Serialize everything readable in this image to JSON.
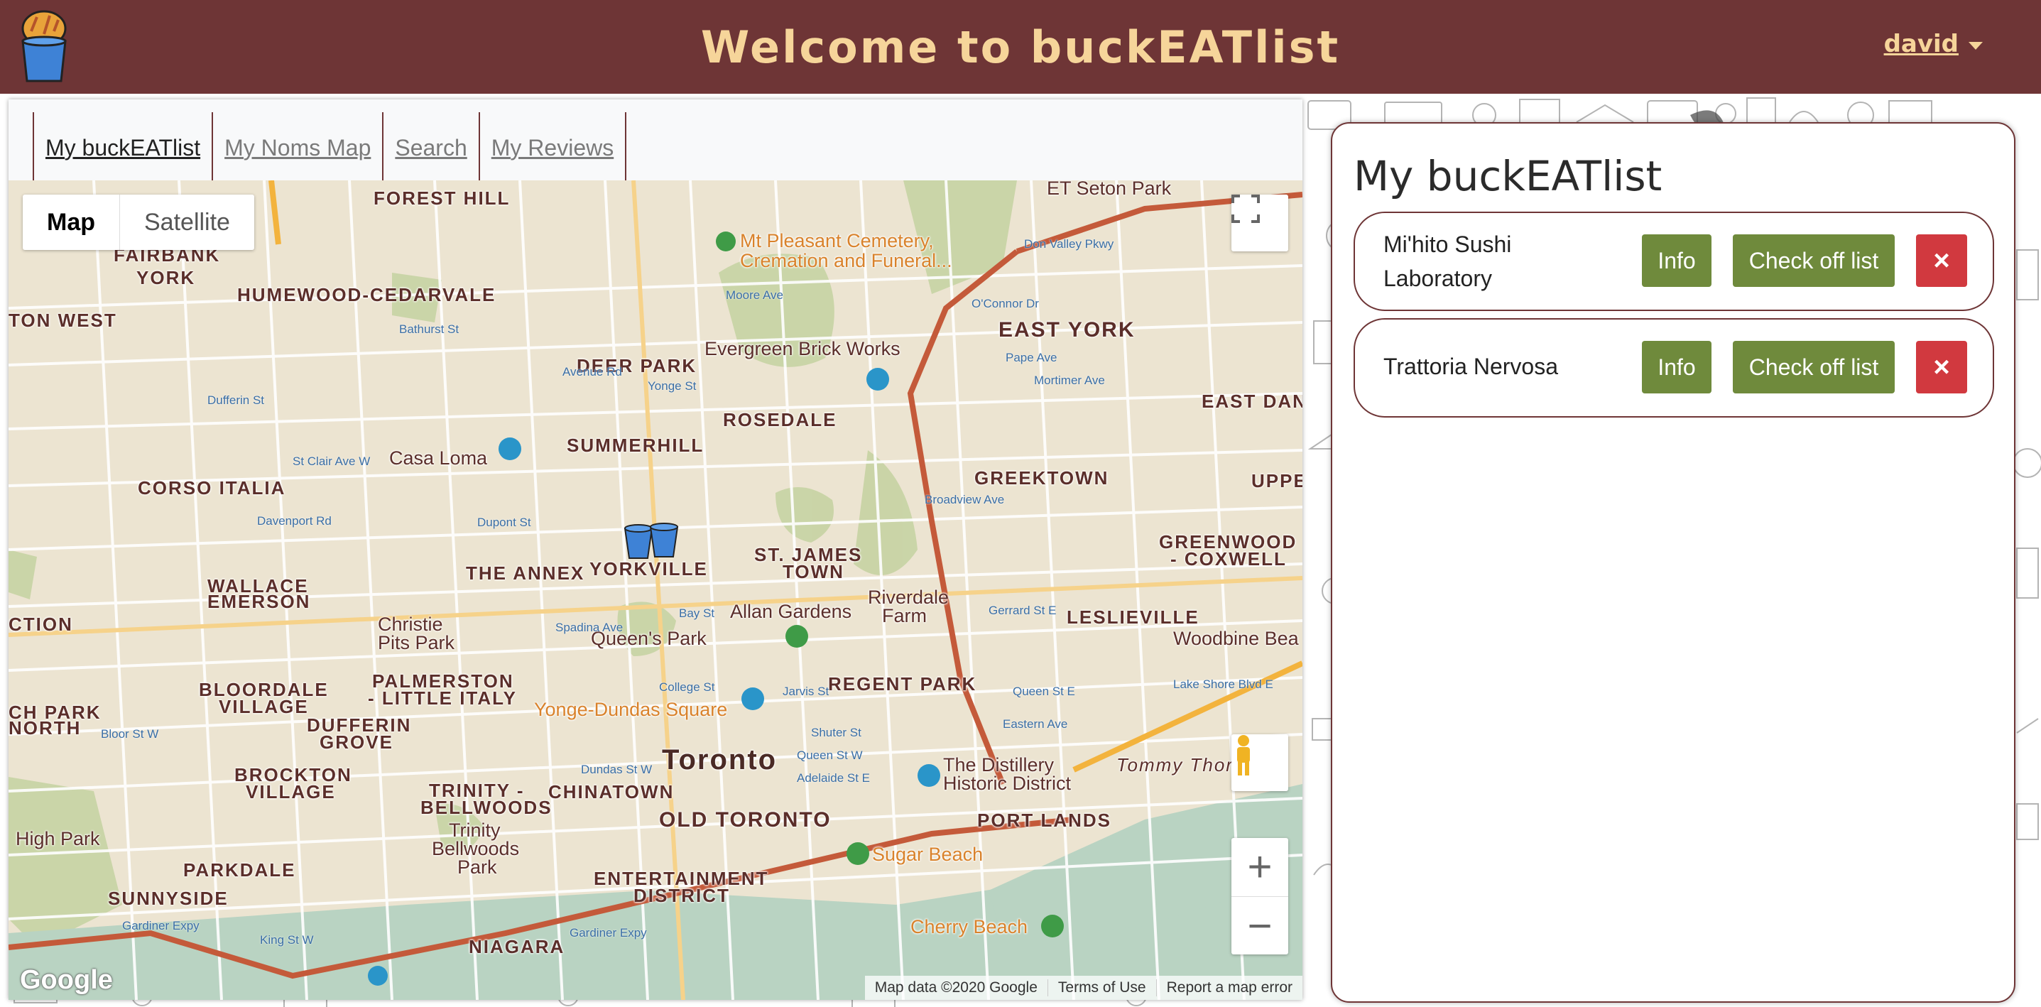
{
  "header": {
    "title": "Welcome to buckEATlist",
    "user": "david",
    "logo_icon": "bucket-logo-icon"
  },
  "nav": {
    "items": [
      {
        "label": "My buckEATlist",
        "active": true
      },
      {
        "label": "My Noms Map",
        "active": false
      },
      {
        "label": "Search",
        "active": false
      },
      {
        "label": "My Reviews",
        "active": false
      }
    ]
  },
  "map": {
    "type_options": [
      "Map",
      "Satellite"
    ],
    "selected_type": "Map",
    "attribution": [
      "Map data ©2020 Google",
      "Terms of Use",
      "Report a map error"
    ],
    "google_logo": "Google",
    "labels": {
      "forest_hill": "FOREST HILL",
      "fairbank": "FAIRBANK",
      "york": "YORK",
      "humewood": "HUMEWOOD-CEDARVALE",
      "ton_west": "TON WEST",
      "mt_pleasant": "Mt Pleasant Cemetery,",
      "mt_pleasant2": "Cremation and Funeral...",
      "et_seton": "ET Seton Park",
      "don_valley": "Don Valley Pkwy",
      "evergreen": "Evergreen Brick Works",
      "deer_park": "DEER PARK",
      "east_york": "EAST YORK",
      "rosedale": "ROSEDALE",
      "east_dan": "EAST DAN",
      "casa_loma": "Casa Loma",
      "summerhill": "SUMMERHILL",
      "corso_italia": "CORSO ITALIA",
      "greektown": "GREEKTOWN",
      "uppe": "UPPE",
      "greenwood": "GREENWOOD",
      "coxwell": "- COXWELL",
      "the_annex": "THE ANNEX",
      "yorkville": "YORKVILLE",
      "st_james": "ST. JAMES",
      "town": "TOWN",
      "wallace": "WALLACE",
      "emerson": "EMERSON",
      "christie": "Christie",
      "pits_park": "Pits Park",
      "allan_gardens": "Allan Gardens",
      "riverdale": "Riverdale",
      "farm": "Farm",
      "leslieville": "LESLIEVILLE",
      "ction": "CTION",
      "queens_park": "Queen's Park",
      "woodbine": "Woodbine Bea",
      "bloordale": "BLOORDALE",
      "village": "VILLAGE",
      "palmerston": "PALMERSTON",
      "little_italy": "- LITTLE ITALY",
      "regent_park": "REGENT PARK",
      "ch_park": "CH PARK",
      "north": "NORTH",
      "dufferin": "DUFFERIN",
      "grove": "GROVE",
      "yonge_dundas": "Yonge-Dundas Square",
      "toronto": "Toronto",
      "distillery": "The Distillery",
      "distillery2": "Historic District",
      "tommy": "Tommy Thor",
      "brockton": "BROCKTON",
      "brockton2": "VILLAGE",
      "trinity": "TRINITY -",
      "bellwoods": "BELLWOODS",
      "chinatown": "CHINATOWN",
      "old_toronto": "OLD TORONTO",
      "port_lands": "PORT LANDS",
      "high_park": "High Park",
      "trinity_park": "Trinity",
      "trinity_park2": "Bellwoods",
      "trinity_park3": "Park",
      "sugar_beach": "Sugar Beach",
      "parkdale": "PARKDALE",
      "entertainment": "ENTERTAINMENT",
      "district": "DISTRICT",
      "sunnyside": "SUNNYSIDE",
      "cherry_beach": "Cherry Beach",
      "gardiner1": "Gardiner Expy",
      "gardiner2": "Gardiner Expy",
      "niagara": "NIAGARA"
    },
    "streets": {
      "a": "St Clair Ave W",
      "b": "Davenport Rd",
      "c": "Dupont St",
      "d": "Bloor St W",
      "e": "Dundas St W",
      "f": "College St",
      "g": "Queen St W",
      "h": "King St W",
      "i": "Gerrard St E",
      "j": "Queen St E",
      "k": "Eastern Ave",
      "l": "Lake Shore Blvd E",
      "m": "Mortimer Ave",
      "n": "O'Connor Dr",
      "o": "Moore Ave",
      "p": "Bathurst St",
      "q": "Spadina Ave",
      "r": "Yonge St",
      "s": "Bay St",
      "t": "Jarvis St",
      "u": "Broadview Ave",
      "v": "Pape Ave",
      "w": "Dufferin St",
      "x": "Avenue Rd",
      "y": "Adelaide St E",
      "z": "Shuter St"
    }
  },
  "bucketlist": {
    "title": "My buckEATlist",
    "items": [
      {
        "name_line1": "Mi'hito Sushi",
        "name_line2": "Laboratory",
        "info_label": "Info",
        "check_label": "Check off list",
        "delete_label": "×"
      },
      {
        "name_line1": "Trattoria Nervosa",
        "name_line2": "",
        "info_label": "Info",
        "check_label": "Check off list",
        "delete_label": "×"
      }
    ]
  },
  "colors": {
    "header_bg": "#6e3536",
    "header_text": "#f6d59a",
    "button_green": "#6f8a3c",
    "button_red": "#d1393f"
  }
}
